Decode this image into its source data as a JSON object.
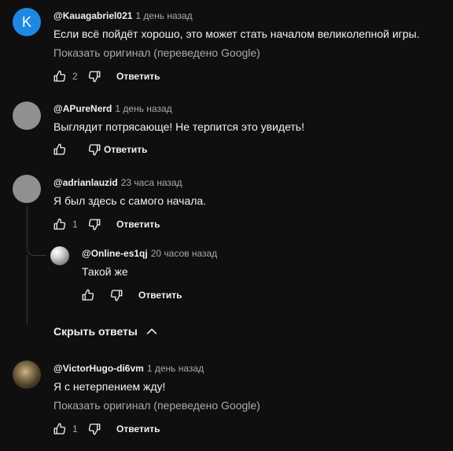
{
  "reply_label": "Ответить",
  "translate_label": "Показать оригинал (переведено Google)",
  "comments": [
    {
      "author": "@Kauagabriel021",
      "time": "1 день назад",
      "avatar_letter": "K",
      "text": "Если всё пойдёт хорошо, это может стать началом великолепной игры.",
      "likes": "2"
    },
    {
      "author": "@APureNerd",
      "time": "1 день назад",
      "text": "Выглядит потрясающе! Не терпится это увидеть!",
      "likes": ""
    },
    {
      "author": "@adrianlauzid",
      "time": "23 часа назад",
      "text": "Я был здесь с самого начала.",
      "likes": "1",
      "replies": [
        {
          "author": "@Online-es1qj",
          "time": "20 часов назад",
          "text": "Такой же",
          "likes": ""
        }
      ],
      "hide_replies_label": "Скрыть ответы"
    },
    {
      "author": "@VictorHugo-di6vm",
      "time": "1 день назад",
      "text": "Я с нетерпением жду!",
      "likes": "1"
    }
  ],
  "colors": {
    "background": "#0f0f0f",
    "text_primary": "#f1f1f1",
    "text_secondary": "#aaaaaa",
    "avatar_k": "#1e88e5",
    "avatar_grey": "#909090"
  }
}
